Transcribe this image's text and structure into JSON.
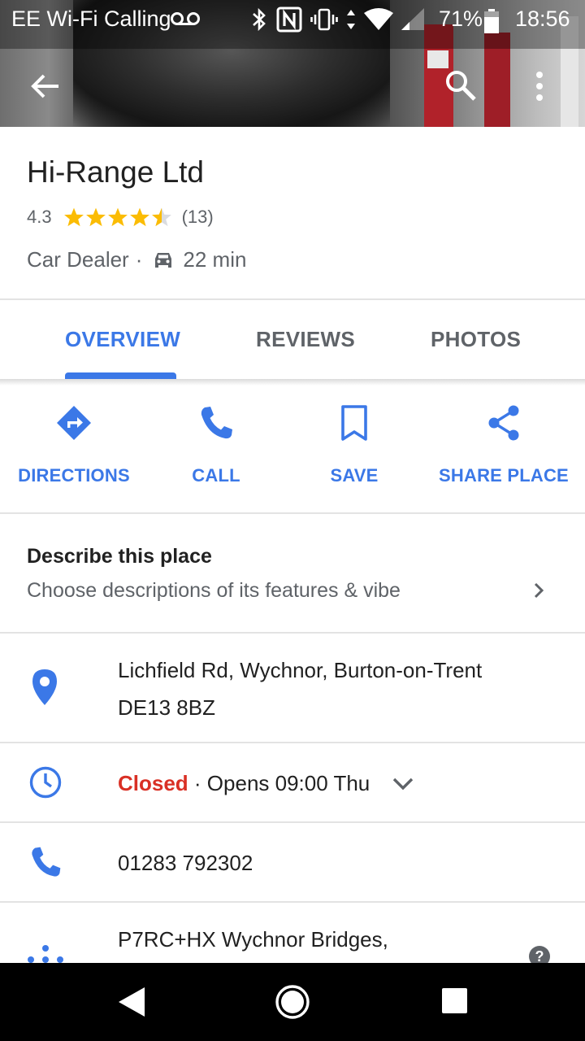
{
  "status_bar": {
    "carrier": "EE Wi-Fi Calling",
    "battery_pct": "71%",
    "time": "18:56"
  },
  "place": {
    "name": "Hi-Range Ltd",
    "rating": "4.3",
    "rating_value": 4.3,
    "review_count": "(13)",
    "category": "Car Dealer",
    "separator": "·",
    "drive_time": "22 min"
  },
  "tabs": [
    {
      "label": "OVERVIEW",
      "active": true
    },
    {
      "label": "REVIEWS",
      "active": false
    },
    {
      "label": "PHOTOS",
      "active": false
    }
  ],
  "actions": [
    {
      "label": "DIRECTIONS",
      "icon": "directions-icon"
    },
    {
      "label": "CALL",
      "icon": "phone-icon"
    },
    {
      "label": "SAVE",
      "icon": "bookmark-icon"
    },
    {
      "label": "SHARE PLACE",
      "icon": "share-icon"
    }
  ],
  "describe": {
    "heading": "Describe this place",
    "subtext": "Choose descriptions of its features & vibe"
  },
  "info": {
    "address_line1": "Lichfield Rd, Wychnor, Burton-on-Trent",
    "address_line2": "DE13 8BZ",
    "hours_status": "Closed",
    "hours_detail": "· Opens 09:00 Thu",
    "phone": "01283 792302",
    "plus_code": "P7RC+HX Wychnor Bridges,"
  },
  "colors": {
    "accent": "#3b78e7",
    "closed": "#d93025",
    "star": "#fbbc04"
  }
}
